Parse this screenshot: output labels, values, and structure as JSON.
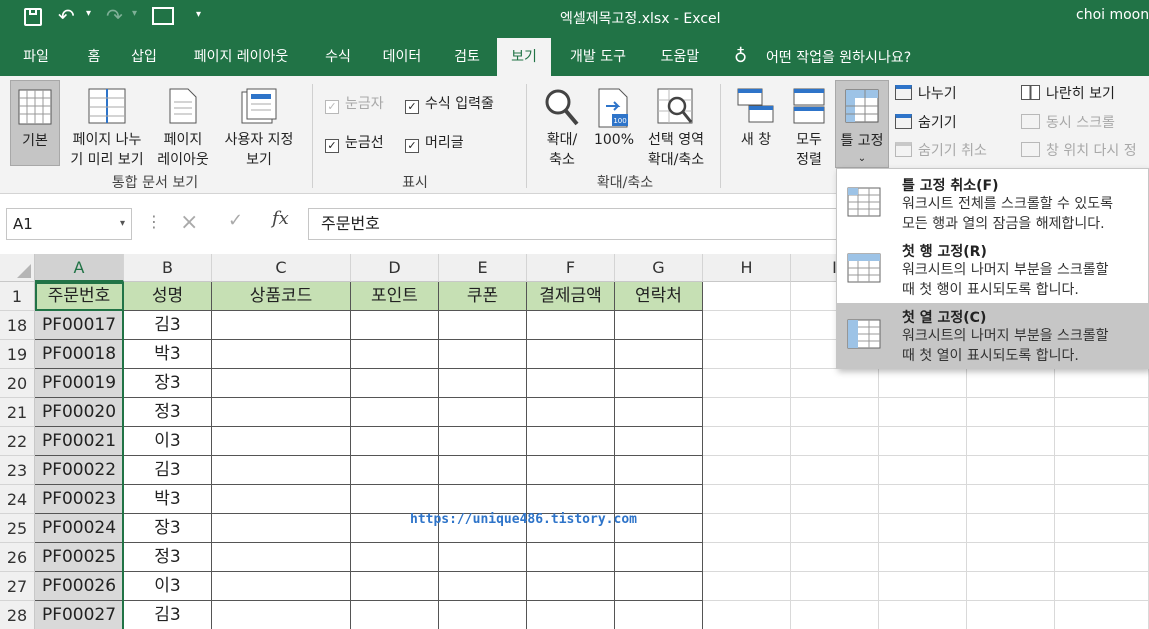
{
  "titlebar": {
    "title": "엑셀제목고정.xlsx  -  Excel",
    "user": "choi moon"
  },
  "tabs": [
    {
      "label": "파일"
    },
    {
      "label": "홈"
    },
    {
      "label": "삽입"
    },
    {
      "label": "페이지 레이아웃"
    },
    {
      "label": "수식"
    },
    {
      "label": "데이터"
    },
    {
      "label": "검토"
    },
    {
      "label": "보기"
    },
    {
      "label": "개발 도구"
    },
    {
      "label": "도움말"
    }
  ],
  "tell_me": "어떤 작업을 원하시나요?",
  "ribbon": {
    "views": {
      "normal": "기본",
      "page_break_1": "페이지 나누",
      "page_break_2": "기 미리 보기",
      "page_layout_1": "페이지",
      "page_layout_2": "레이아웃",
      "custom_1": "사용자 지정",
      "custom_2": "보기",
      "group": "통합 문서 보기"
    },
    "show": {
      "ruler": "눈금자",
      "formula_bar": "수식 입력줄",
      "gridlines": "눈금선",
      "headings": "머리글",
      "group": "표시"
    },
    "zoom": {
      "zoom_1": "확대/",
      "zoom_2": "축소",
      "hundred": "100%",
      "sel_1": "선택 영역",
      "sel_2": "확대/축소",
      "group": "확대/축소"
    },
    "window": {
      "new_window": "새 창",
      "arrange_1": "모두",
      "arrange_2": "정렬",
      "freeze": "틀 고정",
      "split": "나누기",
      "hide": "숨기기",
      "unhide": "숨기기 취소",
      "side_by_side": "나란히 보기",
      "sync_scroll": "동시 스크롤",
      "reset_position": "창 위치 다시 정"
    }
  },
  "formula_bar": {
    "name_box": "A1",
    "content": "주문번호"
  },
  "columns": [
    "A",
    "B",
    "C",
    "D",
    "E",
    "F",
    "G",
    "H",
    "I"
  ],
  "header_row": {
    "num": "1",
    "cells": [
      "주문번호",
      "성명",
      "상품코드",
      "포인트",
      "쿠폰",
      "결제금액",
      "연락처"
    ]
  },
  "rows": [
    {
      "num": "18",
      "a": "PF00017",
      "b": "김3"
    },
    {
      "num": "19",
      "a": "PF00018",
      "b": "박3"
    },
    {
      "num": "20",
      "a": "PF00019",
      "b": "장3"
    },
    {
      "num": "21",
      "a": "PF00020",
      "b": "정3"
    },
    {
      "num": "22",
      "a": "PF00021",
      "b": "이3"
    },
    {
      "num": "23",
      "a": "PF00022",
      "b": "김3"
    },
    {
      "num": "24",
      "a": "PF00023",
      "b": "박3"
    },
    {
      "num": "25",
      "a": "PF00024",
      "b": "장3"
    },
    {
      "num": "26",
      "a": "PF00025",
      "b": "정3"
    },
    {
      "num": "27",
      "a": "PF00026",
      "b": "이3"
    },
    {
      "num": "28",
      "a": "PF00027",
      "b": "김3"
    }
  ],
  "freeze_menu": [
    {
      "title": "틀 고정 취소(F)",
      "desc1": "워크시트 전체를 스크롤할 수 있도록",
      "desc2": "모든 행과 열의 잠금을 해제합니다."
    },
    {
      "title": "첫 행 고정(R)",
      "desc1": "워크시트의 나머지 부분을 스크롤할",
      "desc2": "때 첫 행이 표시되도록 합니다."
    },
    {
      "title": "첫 열 고정(C)",
      "desc1": "워크시트의 나머지 부분을 스크롤할",
      "desc2": "때 첫 열이 표시되도록 합니다."
    }
  ],
  "watermark": "https://unique486.tistory.com"
}
